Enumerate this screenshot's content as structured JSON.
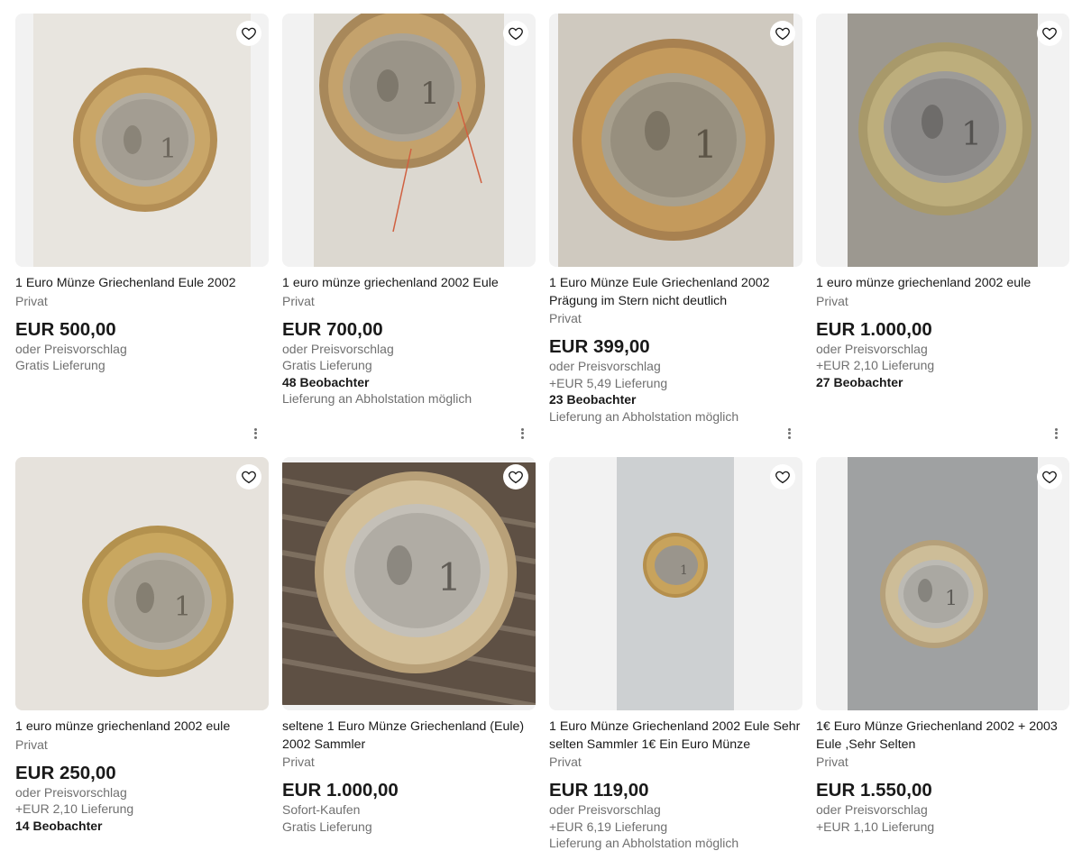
{
  "listings": [
    {
      "title": "1 Euro Münze Griechenland Eule 2002",
      "seller": "Privat",
      "price": "EUR 500,00",
      "offer": "oder Preisvorschlag",
      "shipping": "Gratis Lieferung",
      "watchers": "",
      "pickup": ""
    },
    {
      "title": "1 euro münze griechenland 2002 Eule",
      "seller": "Privat",
      "price": "EUR 700,00",
      "offer": "oder Preisvorschlag",
      "shipping": "Gratis Lieferung",
      "watchers": "48 Beobachter",
      "pickup": "Lieferung an Abholstation möglich"
    },
    {
      "title": "1 Euro Münze Eule Griechenland 2002 Prägung im Stern nicht deutlich",
      "seller": "Privat",
      "price": "EUR 399,00",
      "offer": "oder Preisvorschlag",
      "shipping": "+EUR 5,49 Lieferung",
      "watchers": "23 Beobachter",
      "pickup": "Lieferung an Abholstation möglich"
    },
    {
      "title": "1 euro münze griechenland 2002 eule",
      "seller": "Privat",
      "price": "EUR 1.000,00",
      "offer": "oder Preisvorschlag",
      "shipping": "+EUR 2,10 Lieferung",
      "watchers": "27 Beobachter",
      "pickup": ""
    },
    {
      "title": "1 euro münze griechenland 2002 eule",
      "seller": "Privat",
      "price": "EUR 250,00",
      "offer": "oder Preisvorschlag",
      "shipping": "+EUR 2,10 Lieferung",
      "watchers": "14 Beobachter",
      "pickup": ""
    },
    {
      "title": "seltene 1 Euro Münze Griechenland (Eule) 2002 Sammler",
      "seller": "Privat",
      "price": "EUR 1.000,00",
      "offer": "Sofort-Kaufen",
      "shipping": "Gratis Lieferung",
      "watchers": "",
      "pickup": ""
    },
    {
      "title": "1 Euro Münze Griechenland 2002 Eule Sehr selten Sammler 1€ Ein Euro Münze",
      "seller": "Privat",
      "price": "EUR 119,00",
      "offer": "oder Preisvorschlag",
      "shipping": "+EUR 6,19 Lieferung",
      "watchers": "",
      "pickup": "Lieferung an Abholstation möglich"
    },
    {
      "title": "1€ Euro Münze Griechenland 2002 + 2003 Eule ,Sehr Selten",
      "seller": "Privat",
      "price": "EUR 1.550,00",
      "offer": "oder Preisvorschlag",
      "shipping": "+EUR 1,10 Lieferung",
      "watchers": "",
      "pickup": ""
    }
  ],
  "icons": {
    "watch": "heart-outline-icon",
    "more": "more-vertical-icon"
  },
  "colors": {
    "text": "#191919",
    "secondary": "#707070",
    "tile_bg": "#f2f2f2",
    "coin_gold": "#c8a05a",
    "coin_silver": "#b8b4a8"
  }
}
